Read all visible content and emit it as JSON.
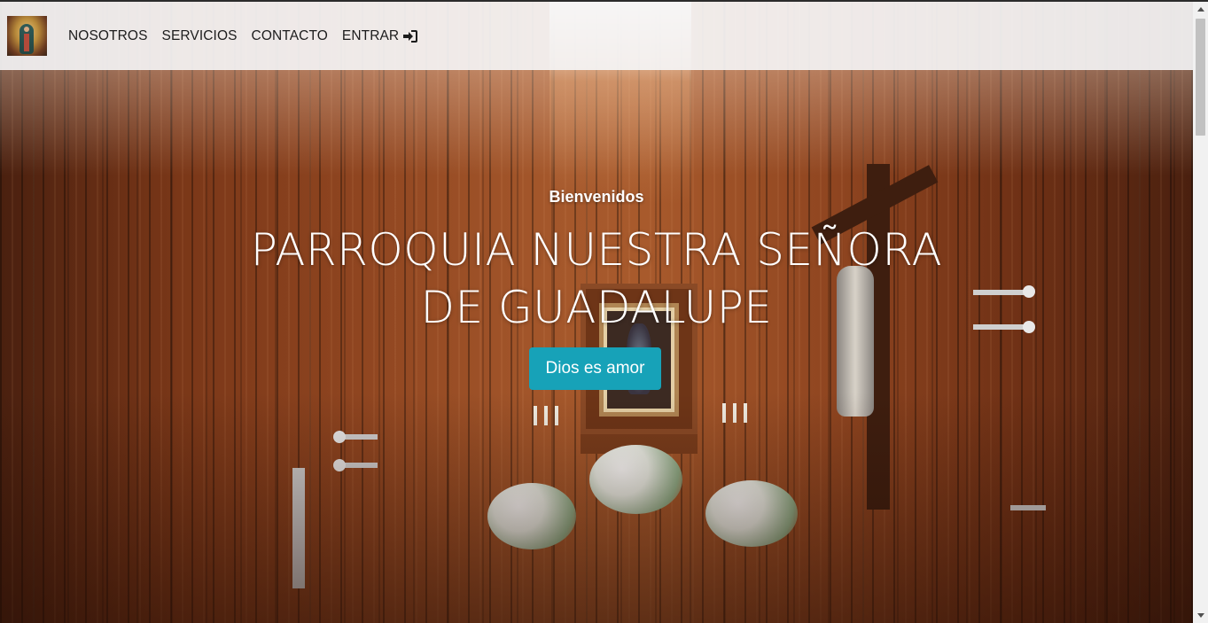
{
  "navbar": {
    "brand_icon": "virgin-of-guadalupe-logo",
    "links": [
      {
        "label": "NOSOTROS"
      },
      {
        "label": "SERVICIOS"
      },
      {
        "label": "CONTACTO"
      },
      {
        "label": "ENTRAR",
        "icon": "sign-in-icon"
      }
    ]
  },
  "hero": {
    "greeting": "Bienvenidos",
    "title": "PARROQUIA NUESTRA SEÑORA DE GUADALUPE",
    "button_label": "Dios es amor"
  },
  "colors": {
    "accent": "#17a2b8",
    "navbar_bg": "#f6f6f8",
    "nav_text": "#1c1c1c",
    "hero_text": "#ffffff"
  }
}
